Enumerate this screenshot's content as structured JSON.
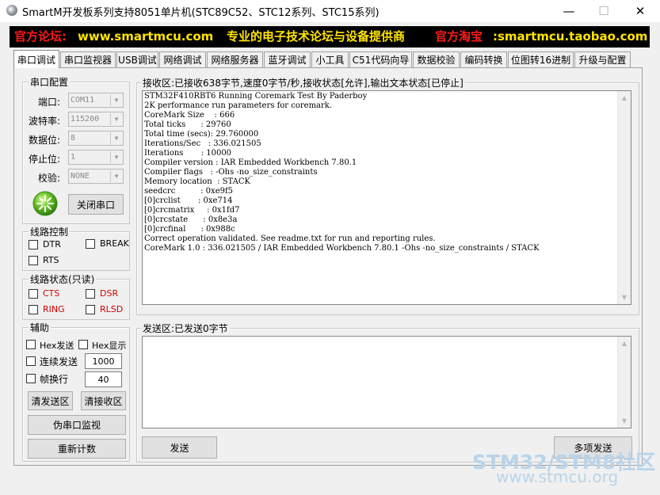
{
  "window": {
    "title": "SmartM开发板系列支持8051单片机(STC89C52、STC12系列、STC15系列)",
    "minimize_glyph": "—",
    "maximize_glyph": "☐",
    "close_glyph": "✕"
  },
  "banner": {
    "forum_label": "官方论坛:",
    "forum_url": "www.smartmcu.com",
    "slogan": "专业的电子技术论坛与设备提供商",
    "shop_label": "官方淘宝",
    "shop_url": ":smartmcu.taobao.com",
    "colors": {
      "red": "#ff1a1a",
      "yellow": "#ffe400",
      "background": "#000000"
    }
  },
  "tabs": [
    "串口调试",
    "串口监视器",
    "USB调试",
    "网络调试",
    "网络服务器",
    "蓝牙调试",
    "小工具",
    "C51代码向导",
    "数据校验",
    "编码转换",
    "位图转16进制",
    "升级与配置"
  ],
  "serial_config": {
    "title": "串口配置",
    "port_label": "端口:",
    "port_value": "COM11",
    "baud_label": "波特率:",
    "baud_value": "115200",
    "databits_label": "数据位:",
    "databits_value": "8",
    "stopbits_label": "停止位:",
    "stopbits_value": "1",
    "parity_label": "校验:",
    "parity_value": "NONE",
    "close_button": "关闭串口",
    "status_icon": "port-open-green-icon"
  },
  "line_control": {
    "title": "线路控制",
    "dtr": "DTR",
    "break": "BREAK",
    "rts": "RTS"
  },
  "line_status": {
    "title": "线路状态(只读)",
    "cts": "CTS",
    "dsr": "DSR",
    "ring": "RING",
    "rlsd": "RLSD"
  },
  "aux": {
    "title": "辅助",
    "hex_send": "Hex发送",
    "hex_display": "Hex显示",
    "auto_send": "连续发送",
    "auto_send_interval": "1000",
    "frame_wrap": "帧换行",
    "frame_wrap_value": "40",
    "clear_send": "清发送区",
    "clear_receive": "清接收区",
    "fake_monitor": "伪串口监视",
    "reset_count": "重新计数"
  },
  "receive": {
    "header": "接收区:已接收638字节,速度0字节/秒,接收状态[允许],输出文本状态[已停止]",
    "lines": [
      "STM32F410RBT6 Running Coremark Test By Paderboy",
      "2K performance run parameters for coremark.",
      "CoreMark Size    : 666",
      "Total ticks      : 29760",
      "Total time (secs): 29.760000",
      "Iterations/Sec   : 336.021505",
      "Iterations       : 10000",
      "Compiler version : IAR Embedded Workbench 7.80.1",
      "Compiler flags   : -Ohs -no_size_constraints",
      "Memory location  : STACK",
      "seedcrc          : 0xe9f5",
      "[0]crclist       : 0xe714",
      "[0]crcmatrix     : 0x1fd7",
      "[0]crcstate      : 0x8e3a",
      "[0]crcfinal      : 0x988c",
      "Correct operation validated. See readme.txt for run and reporting rules.",
      "CoreMark 1.0 : 336.021505 / IAR Embedded Workbench 7.80.1 -Ohs -no_size_constraints / STACK"
    ]
  },
  "send": {
    "header": "发送区:已发送0字节",
    "send_button": "发送",
    "multi_send_button": "多项发送"
  },
  "watermark": {
    "line1": "STM32/STM8社区",
    "line2": "www.stmcu.org"
  }
}
